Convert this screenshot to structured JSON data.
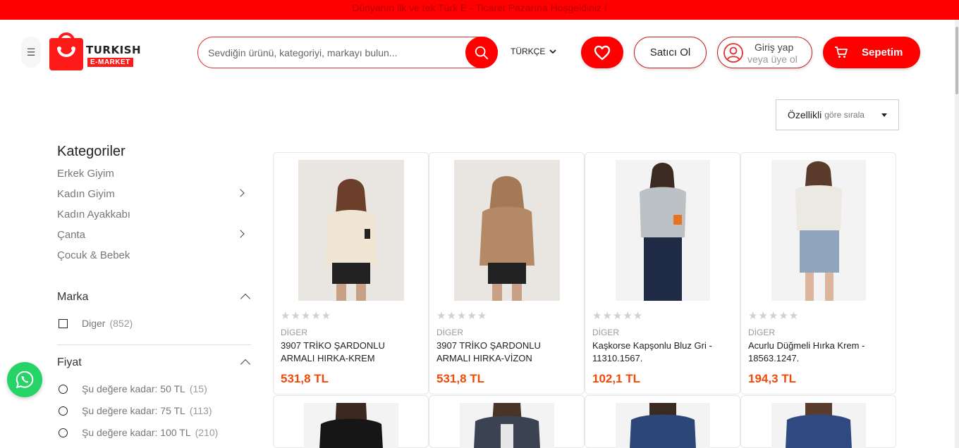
{
  "topbar": {
    "text": "Dünyanın ilk ve tek Türk E - Ticaret Pazarına Hoşgeldiniz !"
  },
  "logo": {
    "name": "TURKISH",
    "sub": "E-MARKET"
  },
  "search": {
    "placeholder": "Sevdiğin ürünü, kategoriyi, markayı bulun..."
  },
  "language": {
    "selected": "TÜRKÇE"
  },
  "header": {
    "seller_label": "Satıcı Ol",
    "login_label": "Giriş yap",
    "register_label": "veya üye ol",
    "cart_label": "Sepetim"
  },
  "sort": {
    "label": "Özellikli",
    "hint": "göre sırala"
  },
  "sidebar": {
    "categories_title": "Kategoriler",
    "categories": [
      {
        "label": "Erkek Giyim"
      },
      {
        "label": "Kadın Giyim"
      },
      {
        "label": "Kadın Ayakkabı"
      },
      {
        "label": "Çanta"
      },
      {
        "label": "Çocuk & Bebek"
      }
    ],
    "brand_title": "Marka",
    "brands": [
      {
        "label": "Diger",
        "count": "(852)"
      }
    ],
    "price_title": "Fiyat",
    "prices": [
      {
        "label": "Şu değere kadar: 50 TL",
        "count": "(15)"
      },
      {
        "label": "Şu değere kadar: 75 TL",
        "count": "(113)"
      },
      {
        "label": "Şu değere kadar: 100 TL",
        "count": "(210)"
      }
    ]
  },
  "products": [
    {
      "brand": "DİGER",
      "title": "3907 TRİKO ŞARDONLU ARMALI HIRKA-KREM",
      "price": "531,8 TL",
      "rating": 0
    },
    {
      "brand": "DİGER",
      "title": "3907 TRİKO ŞARDONLU ARMALI HIRKA-VİZON",
      "price": "531,8 TL",
      "rating": 0
    },
    {
      "brand": "DİGER",
      "title": "Kaşkorse Kapşonlu Bluz Gri - 11310.1567.",
      "price": "102,1 TL",
      "rating": 0
    },
    {
      "brand": "DİGER",
      "title": "Acurlu Düğmeli Hırka Krem - 18563.1247.",
      "price": "194,3 TL",
      "rating": 0
    }
  ],
  "colors": {
    "accent": "#ff0000",
    "price": "#f04a06",
    "whatsapp": "#25d366"
  }
}
